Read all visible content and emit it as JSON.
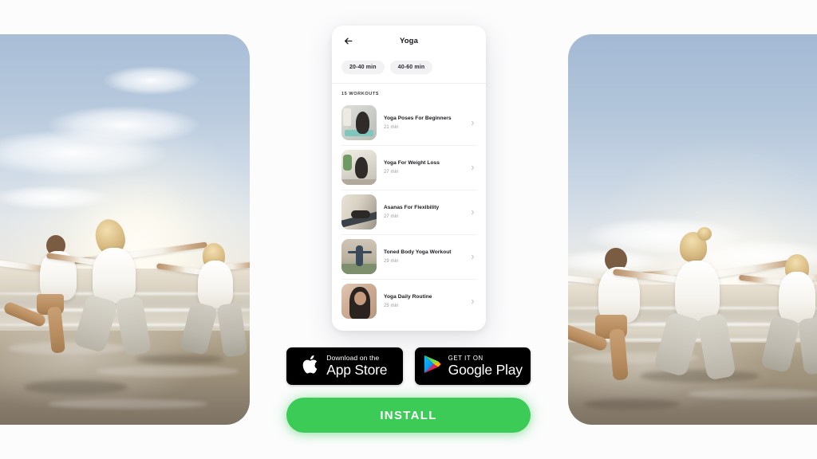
{
  "page": {
    "background_color": "#fcfcfd"
  },
  "left_photo": {
    "alt": "people doing warrior yoga pose on beach at sunrise",
    "icon": "beach-yoga-photo"
  },
  "right_photo": {
    "alt": "people doing warrior yoga pose on beach at sunrise",
    "icon": "beach-yoga-photo"
  },
  "phone": {
    "back_icon": "back-arrow-icon",
    "title": "Yoga",
    "chips": [
      {
        "label": "20-40 min"
      },
      {
        "label": "40-60 min"
      }
    ],
    "section_label": "15 WORKOUTS",
    "workouts": [
      {
        "title": "Yoga Poses For Beginners",
        "duration": "21 min",
        "chevron": "chevron-right-icon"
      },
      {
        "title": "Yoga For Weight Loss",
        "duration": "27 min",
        "chevron": "chevron-right-icon"
      },
      {
        "title": "Asanas For Flexibility",
        "duration": "27 min",
        "chevron": "chevron-right-icon"
      },
      {
        "title": "Toned Body Yoga Workout",
        "duration": "29 min",
        "chevron": "chevron-right-icon"
      },
      {
        "title": "Yoga Daily Routine",
        "duration": "25 min",
        "chevron": "chevron-right-icon"
      }
    ]
  },
  "badges": {
    "apple": {
      "icon": "apple-logo-icon",
      "small_text": "Download on the",
      "big_text": "App Store",
      "background_color": "#000000"
    },
    "google": {
      "icon": "google-play-icon",
      "small_text": "GET IT ON",
      "big_text": "Google Play",
      "background_color": "#000000"
    }
  },
  "install": {
    "label": "INSTALL",
    "color": "#3dcb58"
  }
}
